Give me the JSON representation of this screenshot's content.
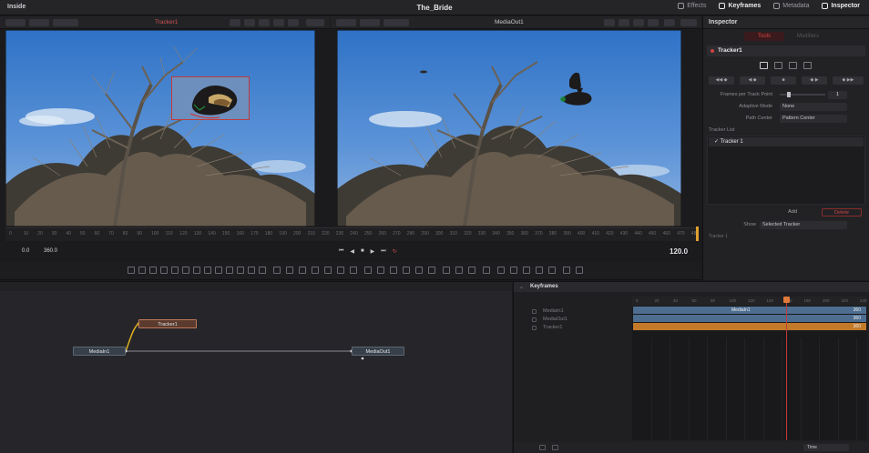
{
  "app": {
    "name": "Inside",
    "project_title": "The_Bride"
  },
  "panels": [
    {
      "label": "Effects",
      "active": false
    },
    {
      "label": "Keyframes",
      "active": true
    },
    {
      "label": "Metadata",
      "active": false
    },
    {
      "label": "Inspector",
      "active": true
    }
  ],
  "viewers": {
    "left": {
      "title": "Tracker1"
    },
    "right": {
      "title": "MediaOut1"
    }
  },
  "ruler": {
    "ticks": [
      "0",
      "10",
      "20",
      "30",
      "40",
      "50",
      "60",
      "70",
      "80",
      "90",
      "100",
      "110",
      "120",
      "130",
      "140",
      "150",
      "160",
      "170",
      "180",
      "190",
      "200",
      "210",
      "220",
      "230",
      "240",
      "250",
      "260",
      "270",
      "280",
      "290",
      "300",
      "310",
      "320",
      "330",
      "340",
      "350",
      "360",
      "370",
      "380",
      "390",
      "400",
      "410",
      "420",
      "430",
      "440",
      "450",
      "460",
      "470",
      "480"
    ]
  },
  "transport": {
    "start": "0.0",
    "end": "360.0",
    "current": "120.0",
    "buttons": [
      "⏮",
      "◀",
      "■",
      "▶",
      "⏭",
      "↻"
    ]
  },
  "inspector": {
    "header": "Inspector",
    "tabs": {
      "tools": "Tools",
      "modifiers": "Modifiers"
    },
    "node_name": "Tracker1",
    "actions": [
      "◀◀ ◆",
      "◀ ◆",
      "■",
      "◆ ▶",
      "◆ ▶▶"
    ],
    "properties": [
      {
        "label": "Frames per Track Point",
        "kind": "slider",
        "value": "1"
      },
      {
        "label": "Adaptive Mode",
        "kind": "select",
        "value": "None"
      },
      {
        "label": "Path Center",
        "kind": "select",
        "value": "Pattern Center"
      }
    ],
    "tracker_list_label": "Tracker List",
    "trackers": [
      "✓  Tracker 1"
    ],
    "add_label": "Add",
    "delete_label": "Delete",
    "show_label": "Show",
    "show_value": "Selected Tracker",
    "sub_label": "Tracker 1"
  },
  "nodes": {
    "media_in": "MediaIn1",
    "tracker": "Tracker1",
    "media_out": "MediaOut1"
  },
  "keyframes": {
    "title": "Keyframes",
    "chevron": "⌄",
    "names": [
      "MediaIn1",
      "MediaOut1",
      "Tracker1"
    ],
    "ruler": [
      "0",
      "20",
      "40",
      "60",
      "80",
      "100",
      "120",
      "140",
      "160",
      "180",
      "200",
      "220",
      "240"
    ],
    "bars": [
      {
        "label": "MediaIn1",
        "length": "360",
        "color": "#4d6e90"
      },
      {
        "label": "",
        "length": "360",
        "color": "#4d6e90"
      },
      {
        "label": "",
        "length": "360",
        "color": "#c27a2a"
      }
    ],
    "time_select": "Time"
  },
  "colors": {
    "accent_red": "#c23a3a",
    "keyframe_blue": "#4d6e90",
    "keyframe_orange": "#c27a2a",
    "playhead": "#e0a030"
  }
}
